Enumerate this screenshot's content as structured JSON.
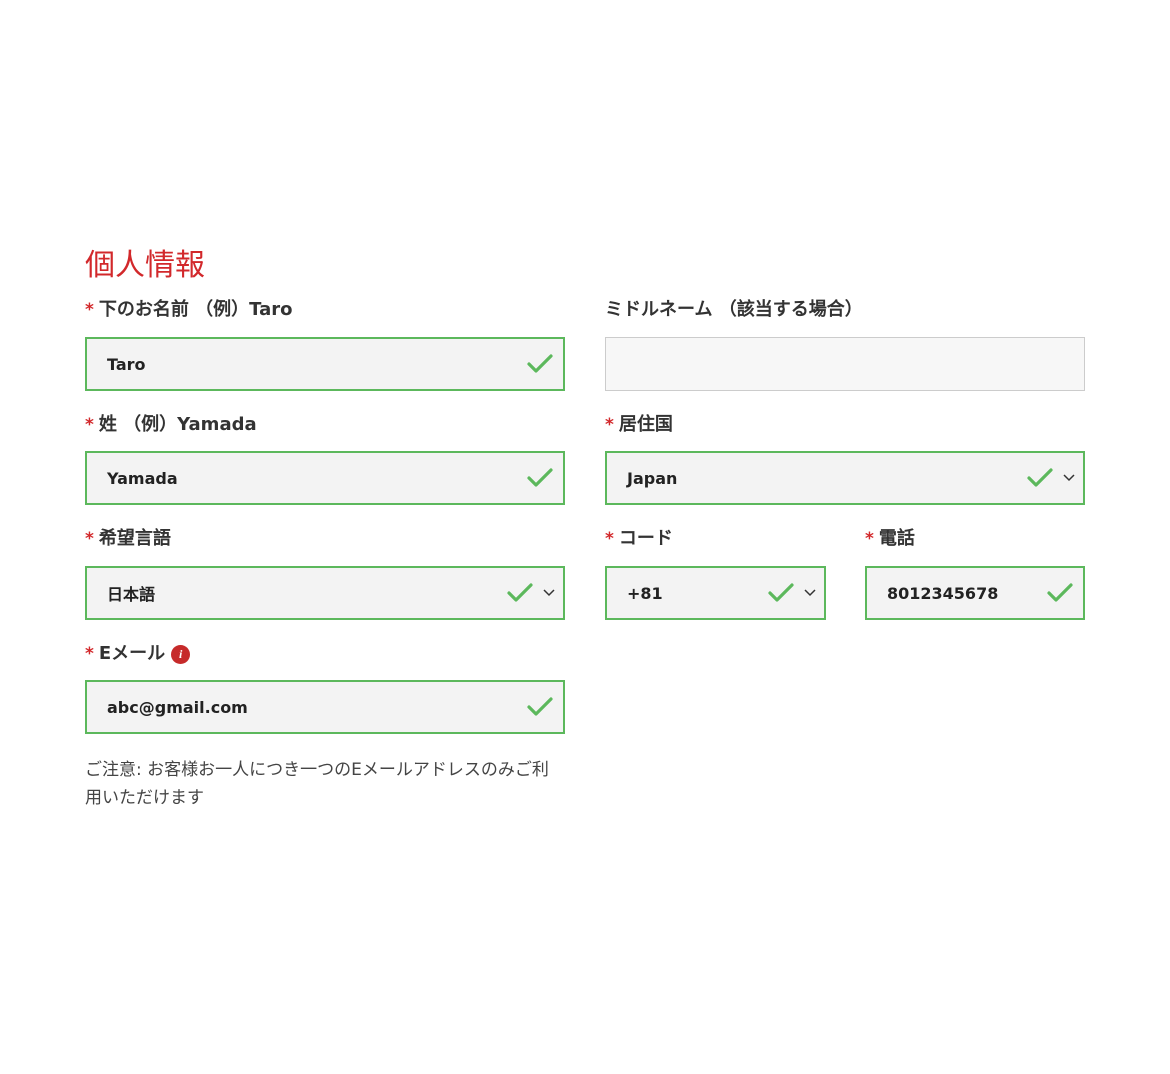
{
  "section": {
    "title": "個人情報"
  },
  "first_name": {
    "required_mark": "*",
    "label": "下のお名前 （例）Taro",
    "value": "Taro"
  },
  "middle_name": {
    "label": "ミドルネーム （該当する場合）",
    "value": ""
  },
  "last_name": {
    "required_mark": "*",
    "label": "姓 （例）Yamada",
    "value": "Yamada"
  },
  "country": {
    "required_mark": "*",
    "label": "居住国",
    "value": "Japan"
  },
  "language": {
    "required_mark": "*",
    "label": "希望言語",
    "value": "日本語"
  },
  "code": {
    "required_mark": "*",
    "label": "コード",
    "value": "+81"
  },
  "phone": {
    "required_mark": "*",
    "label": "電話",
    "value": "8012345678"
  },
  "email": {
    "required_mark": "*",
    "label": "Eメール",
    "info_icon": "i",
    "value": "abc@gmail.com"
  },
  "note": {
    "text": "ご注意: お客様お一人につき一つのEメールアドレスのみご利用いただけます"
  },
  "colors": {
    "accent_red": "#d2282b",
    "valid_green": "#5cb85c",
    "field_bg": "#f3f3f3"
  },
  "icons": {
    "valid": "check-icon",
    "dropdown": "chevron-down-icon",
    "info": "info-icon"
  }
}
